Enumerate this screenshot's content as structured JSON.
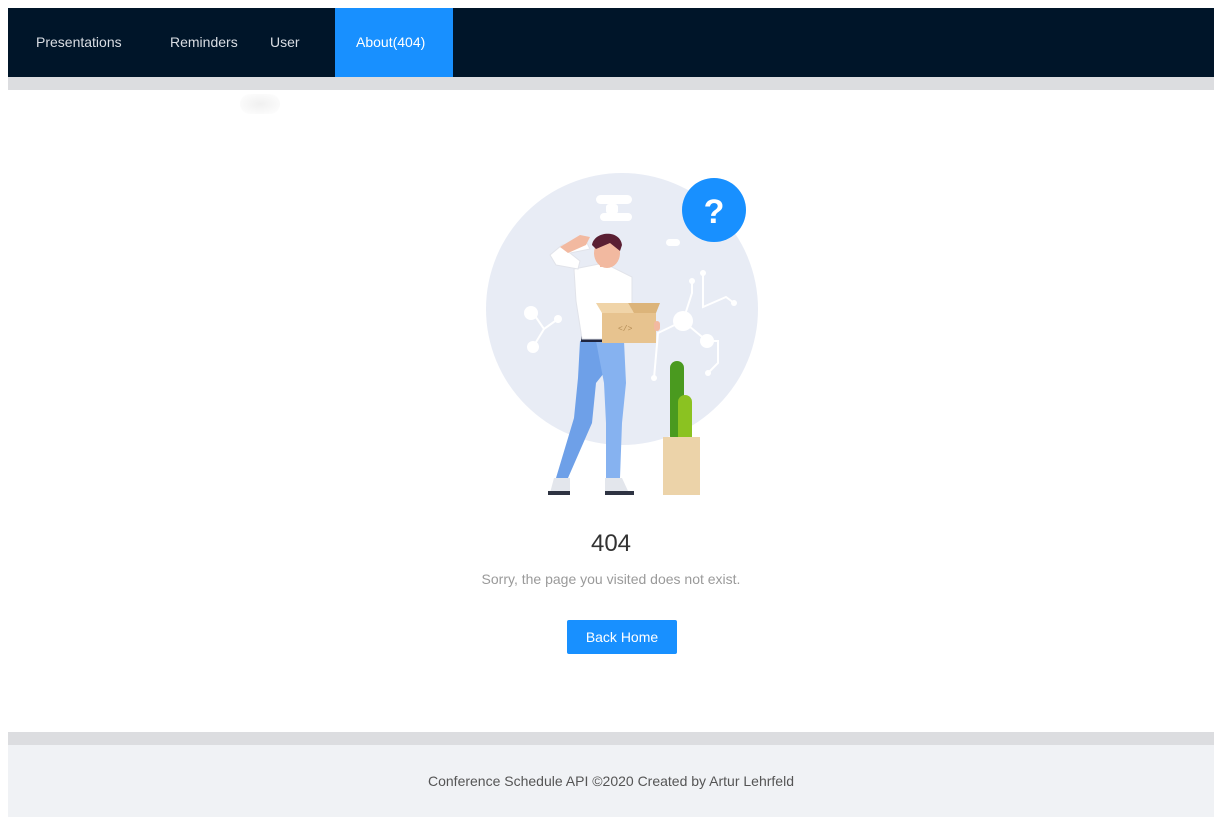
{
  "nav": {
    "items": [
      {
        "label": "Presentations",
        "active": false
      },
      {
        "label": "Reminders",
        "active": false
      },
      {
        "label": "User",
        "active": false
      },
      {
        "label": "About(404)",
        "active": true
      }
    ]
  },
  "result": {
    "illustration_icon": "question-icon",
    "question_mark": "?",
    "status": "404",
    "subtitle": "Sorry, the page you visited does not exist.",
    "button_label": "Back Home"
  },
  "footer": {
    "text": "Conference Schedule API ©2020 Created by Artur Lehrfeld"
  },
  "colors": {
    "nav_bg": "#001529",
    "accent": "#1890ff",
    "footer_bg": "#f0f2f5"
  }
}
